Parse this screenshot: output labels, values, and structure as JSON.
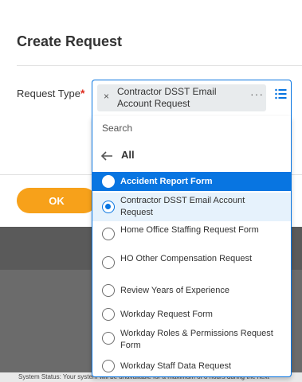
{
  "modal": {
    "title": "Create Request",
    "field_label": "Request Type",
    "required_marker": "*",
    "ok_label": "OK"
  },
  "selected_token": {
    "label": "Contractor DSST Email Account Request",
    "remove_glyph": "×",
    "more_glyph": "···"
  },
  "search": {
    "placeholder": "Search"
  },
  "back": {
    "label": "All"
  },
  "options": [
    {
      "label": "Accident Report Form",
      "state": "highlighted"
    },
    {
      "label": "Contractor DSST Email Account Request",
      "state": "selected"
    },
    {
      "label": "Home Office Staffing Request Form",
      "state": "none"
    },
    {
      "label": "HO Other Compensation Request",
      "state": "none"
    },
    {
      "label": "Review Years of Experience",
      "state": "none"
    },
    {
      "label": "Workday Request Form",
      "state": "none"
    },
    {
      "label": "Workday Roles & Permissions Request Form",
      "state": "none"
    },
    {
      "label": "Workday Staff Data Request",
      "state": "none"
    }
  ],
  "status_bar": {
    "text": "System Status: Your system will be unavailable for a maximum of 8 hours during the next"
  },
  "colors": {
    "accent": "#0875e1",
    "ok_button": "#f7a11a",
    "required": "#de2e21"
  }
}
